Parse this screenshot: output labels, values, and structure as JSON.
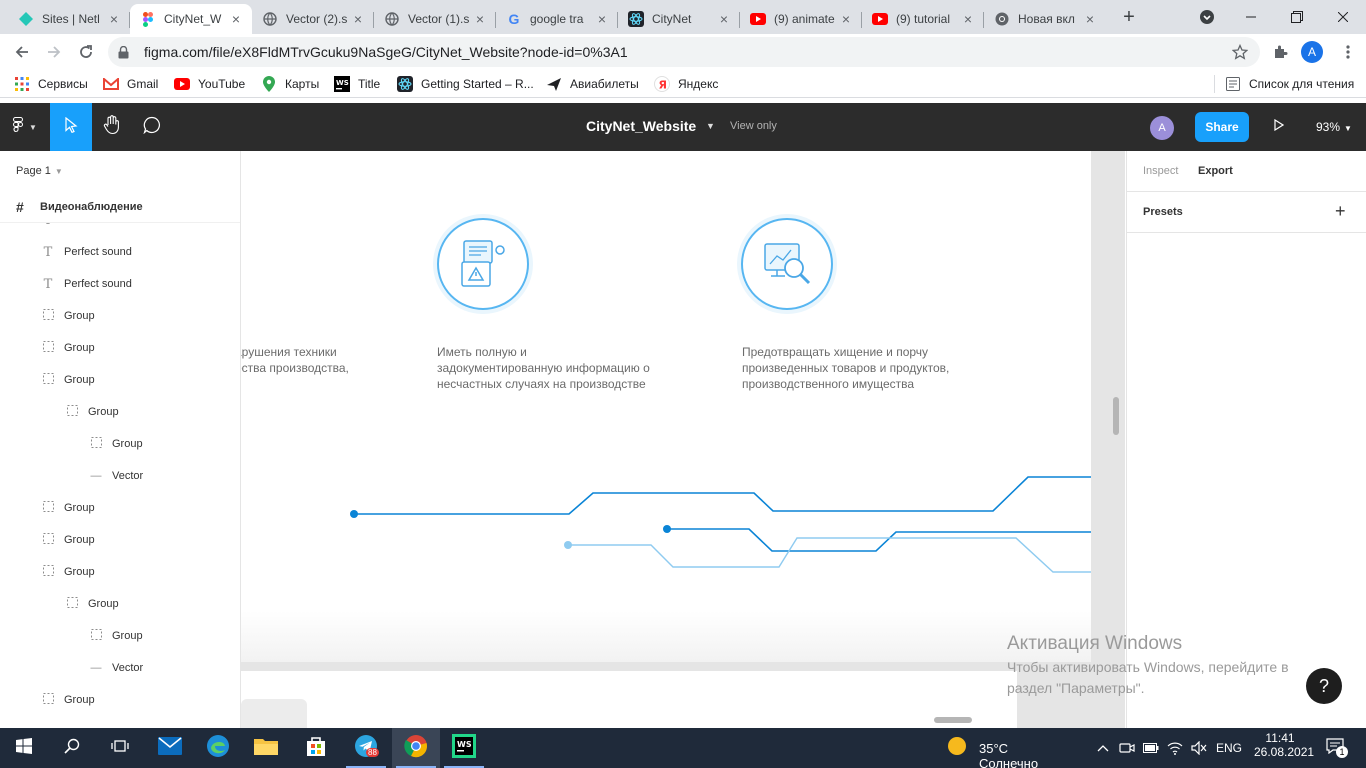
{
  "browser": {
    "tabs": [
      {
        "title": "Sites | Netl",
        "icon": "netlify-icon"
      },
      {
        "title": "CityNet_W",
        "icon": "figma-icon",
        "active": true
      },
      {
        "title": "Vector (2).s",
        "icon": "globe-icon"
      },
      {
        "title": "Vector (1).s",
        "icon": "globe-icon"
      },
      {
        "title": "google tra",
        "icon": "google-icon"
      },
      {
        "title": "CityNet",
        "icon": "react-icon"
      },
      {
        "title": "(9) animate",
        "icon": "youtube-icon"
      },
      {
        "title": "(9) tutorial",
        "icon": "youtube-icon"
      },
      {
        "title": "Новая вкл",
        "icon": "chrome-icon"
      }
    ],
    "url": "figma.com/file/eX8FldMTrvGcuku9NaSgeG/CityNet_Website?node-id=0%3A1",
    "profile_initial": "A",
    "bookmarks": [
      {
        "label": "Сервисы",
        "icon": "apps-grid-icon"
      },
      {
        "label": "Gmail",
        "icon": "gmail-icon"
      },
      {
        "label": "YouTube",
        "icon": "youtube-icon"
      },
      {
        "label": "Карты",
        "icon": "maps-icon"
      },
      {
        "label": "Title",
        "icon": "webstorm-icon"
      },
      {
        "label": "Getting Started – R...",
        "icon": "react-icon"
      },
      {
        "label": "Авиабилеты",
        "icon": "plane-icon"
      },
      {
        "label": "Яндекс",
        "icon": "yandex-icon"
      }
    ],
    "reading_list": "Список для чтения"
  },
  "figma": {
    "file_name": "CityNet_Website",
    "view_mode": "View only",
    "user_initial": "A",
    "share_label": "Share",
    "zoom": "93%",
    "page": "Page 1",
    "frame": "Видеонаблюдение",
    "layers": [
      {
        "label": "Perfect sound",
        "type": "text",
        "depth": 0
      },
      {
        "label": "Perfect sound",
        "type": "text",
        "depth": 0
      },
      {
        "label": "Perfect sound",
        "type": "text",
        "depth": 0
      },
      {
        "label": "Group",
        "type": "group",
        "depth": 0
      },
      {
        "label": "Group",
        "type": "group",
        "depth": 0
      },
      {
        "label": "Group",
        "type": "group",
        "depth": 0
      },
      {
        "label": "Group",
        "type": "group",
        "depth": 1
      },
      {
        "label": "Group",
        "type": "group",
        "depth": 2
      },
      {
        "label": "Vector",
        "type": "vector",
        "depth": 2
      },
      {
        "label": "Group",
        "type": "group",
        "depth": 0
      },
      {
        "label": "Group",
        "type": "group",
        "depth": 0
      },
      {
        "label": "Group",
        "type": "group",
        "depth": 0
      },
      {
        "label": "Group",
        "type": "group",
        "depth": 1
      },
      {
        "label": "Group",
        "type": "group",
        "depth": 2
      },
      {
        "label": "Vector",
        "type": "vector",
        "depth": 2
      },
      {
        "label": "Group",
        "type": "group",
        "depth": 0
      }
    ],
    "right_panel": {
      "tabs": [
        "Inspect",
        "Export"
      ],
      "active_tab": "Export",
      "presets_label": "Presets"
    }
  },
  "canvas": {
    "features": [
      {
        "text": "арушения техники\nества производства,"
      },
      {
        "text": "Иметь полную и\nзадокументированную информацию о\nнесчастных случаях на производстве"
      },
      {
        "text": "Предотвращать хищение и порчу\nпроизведенных товаров и продуктов,\nпроизводственного имущества"
      }
    ],
    "accent_color": "#0a84d6",
    "light_accent_color": "#8fcbf0"
  },
  "watermark": {
    "title": "Активация Windows",
    "text": "Чтобы активировать Windows, перейдите в раздел \"Параметры\"."
  },
  "help_label": "?",
  "taskbar": {
    "weather": "35°C  Солнечно",
    "lang": "ENG",
    "time": "11:41",
    "date": "26.08.2021",
    "telegram_badge": "88",
    "notif_count": "1"
  }
}
